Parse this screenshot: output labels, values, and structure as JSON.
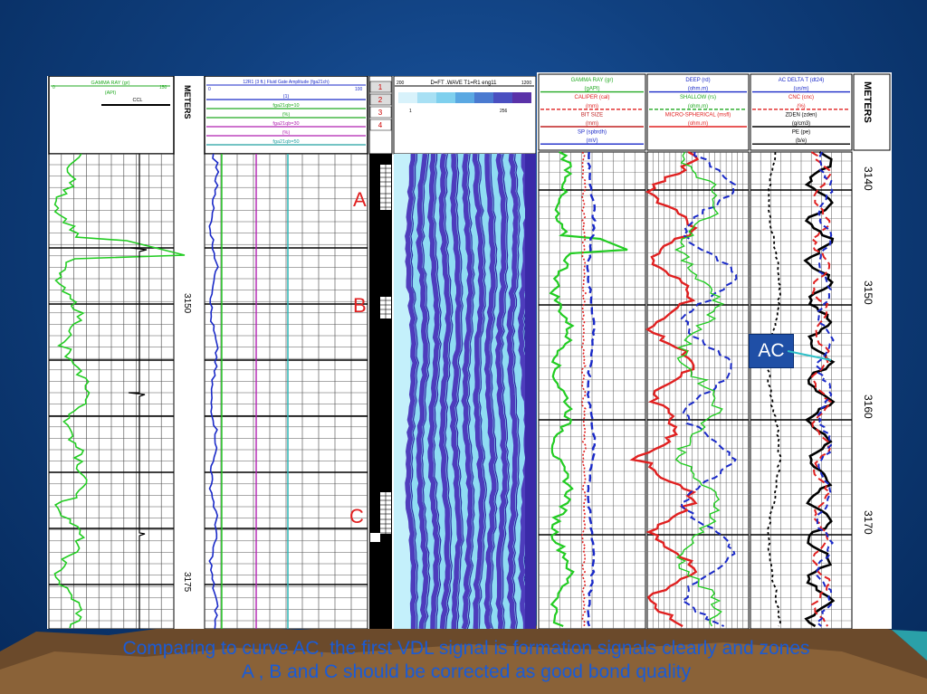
{
  "colors": {
    "background": "#10407f",
    "caption": "#1a5bd6",
    "marker": "#e02020",
    "ac_box": "#1f4fa6",
    "gamma_ray": "#22cc22",
    "amplitude": "#1a2ac8",
    "deep": "#e02020",
    "vdl_dark": "#4a33b8",
    "vdl_light": "#7fd8f0"
  },
  "left_log": {
    "gamma_header": "GAMMA RAY (gr)",
    "gamma_unit": "(API)",
    "gamma_min": "0",
    "gamma_max": "150",
    "ccl_label": "CCL",
    "depth_header": "METERS",
    "depth_top": "3150",
    "depth_bottom": "3175",
    "amp_header": "12R1 (3 ft.) Fluid Gate Amplitude (fga21ch)",
    "amp_min": "0",
    "amp_max": "100",
    "amp_rows": [
      "(1)",
      "fga21qb=10",
      "(%)",
      "fga21qb=30",
      "(%)",
      "fga21qb=50"
    ],
    "quality_scale": [
      "1",
      "2",
      "3",
      "4"
    ],
    "vdl_header": "D=FT .WAVE T1=R1 eng11",
    "vdl_min": "200",
    "vdl_max": "1200",
    "vdl_scale_low": "1",
    "vdl_scale_high": "256"
  },
  "right_log": {
    "track1_lines": [
      "GAMMA RAY (gr)",
      "(gAPI)",
      "CALIPER (cal)",
      "(mm)",
      "BIT SIZE",
      "(mm)",
      "SP (spbrdh)",
      "(mV)"
    ],
    "track2_lines": [
      "DEEP (rd)",
      "(ohm.m)",
      "SHALLOW (rs)",
      "(ohm.m)",
      "MICRO-SPHERICAL (msfl)",
      "(ohm.m)"
    ],
    "track3_lines": [
      "AC DELTA T (dt24)",
      "(us/m)",
      "CNC (cnc)",
      "(%)",
      "ZDEN (zden)",
      "(g/cm3)",
      "PE (pe)",
      "(b/e)"
    ],
    "depth_header": "METERS",
    "depths": [
      "3140",
      "3150",
      "3160",
      "3170"
    ]
  },
  "markers": [
    "A",
    "B",
    "C"
  ],
  "ac_label": "AC",
  "caption": "Comparing to curve AC, the first VDL signal is formation signals clearly and zones\nA , B and C should be corrected as good bond quality"
}
